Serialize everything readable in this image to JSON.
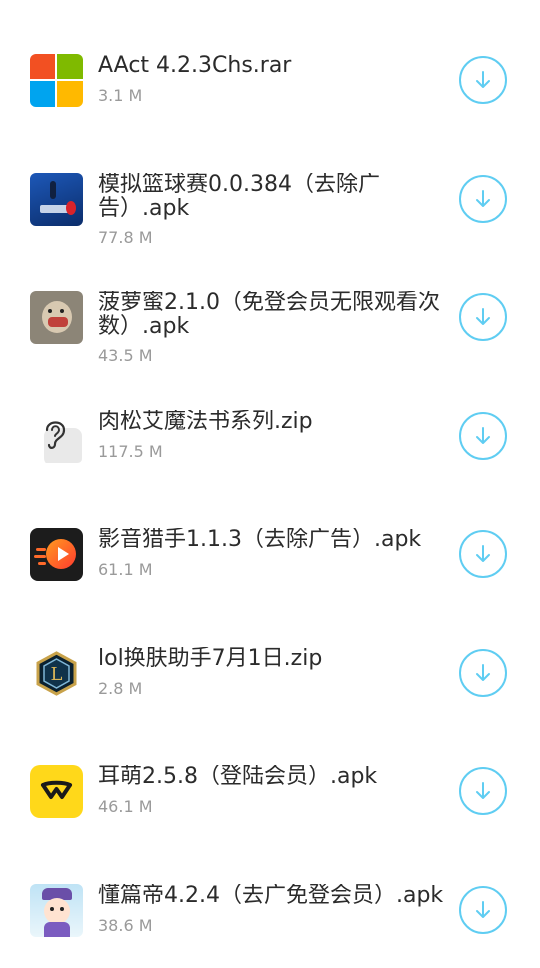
{
  "files": [
    {
      "name": "AAct 4.2.3Chs.rar",
      "size": "3.1 M",
      "icon": "windows-logo-icon"
    },
    {
      "name": "模拟篮球赛0.0.384（去除广告）.apk",
      "size": "77.8 M",
      "icon": "basketball-game-icon"
    },
    {
      "name": "菠萝蜜2.1.0（免登会员无限观看次数）.apk",
      "size": "43.5 M",
      "icon": "hedgehog-icon"
    },
    {
      "name": "肉松艾魔法书系列.zip",
      "size": "117.5 M",
      "icon": "ear-icon"
    },
    {
      "name": "影音猎手1.1.3（去除广告）.apk",
      "size": "61.1 M",
      "icon": "play-icon"
    },
    {
      "name": "lol换肤助手7月1日.zip",
      "size": "2.8 M",
      "icon": "league-logo-icon"
    },
    {
      "name": "耳萌2.5.8（登陆会员）.apk",
      "size": "46.1 M",
      "icon": "ermeng-logo-icon"
    },
    {
      "name": "懂篇帝4.2.4（去广免登会员）.apk",
      "size": "38.6 M",
      "icon": "cartoon-avatar-icon"
    }
  ]
}
